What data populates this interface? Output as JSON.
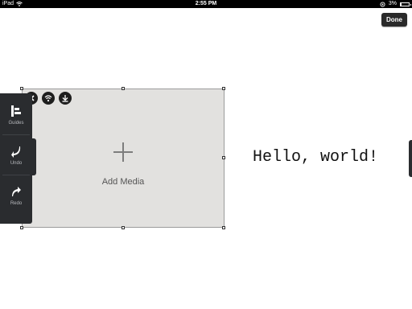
{
  "statusbar": {
    "device": "iPad",
    "time": "2:55 PM",
    "battery_percent": "3%",
    "battery_level": 0.03
  },
  "toolbar": {
    "done_label": "Done"
  },
  "sidebar": {
    "items": [
      {
        "label": "Guides",
        "icon": "guides-icon"
      },
      {
        "label": "Undo",
        "icon": "undo-icon"
      },
      {
        "label": "Redo",
        "icon": "redo-icon"
      }
    ]
  },
  "media": {
    "add_label": "Add Media",
    "icons": [
      "close-icon",
      "wifi-icon",
      "download-icon"
    ]
  },
  "canvas": {
    "text": "Hello, world!"
  }
}
